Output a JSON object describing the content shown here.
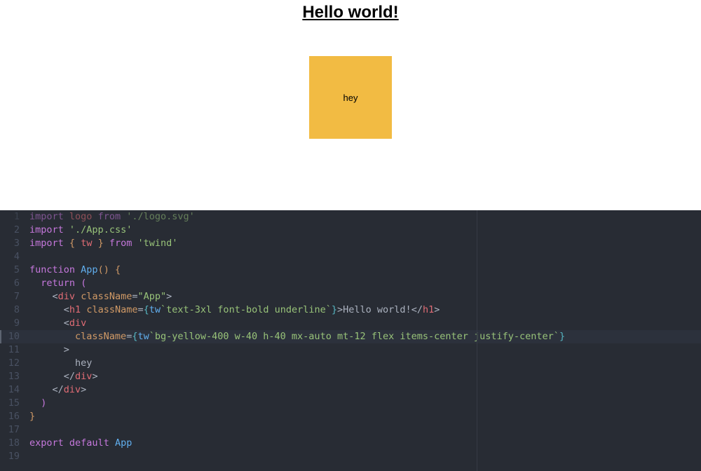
{
  "preview": {
    "heading": "Hello world!",
    "box_text": "hey"
  },
  "editor": {
    "lines": [
      {
        "n": "1",
        "html": "<span class='kw'>import</span> <span class='var'>logo</span> <span class='kw'>from</span> <span class='str'>'./logo.svg'</span>"
      },
      {
        "n": "2",
        "html": "<span class='kw'>import</span> <span class='str'>'./App.css'</span>"
      },
      {
        "n": "3",
        "html": "<span class='kw'>import</span> <span class='bracket1'>{</span> <span class='var'>tw</span> <span class='bracket1'>}</span> <span class='kw'>from</span> <span class='str'>'twind'</span>"
      },
      {
        "n": "4",
        "html": ""
      },
      {
        "n": "5",
        "html": "<span class='kw'>function</span> <span class='fn'>App</span><span class='bracket1'>()</span> <span class='bracket1'>{</span>"
      },
      {
        "n": "6",
        "html": "  <span class='kw'>return</span> <span class='bracket2'>(</span>"
      },
      {
        "n": "7",
        "html": "    <span class='punct'>&lt;</span><span class='tag'>div</span> <span class='attr'>className</span>=<span class='str'>\"App\"</span><span class='punct'>&gt;</span>"
      },
      {
        "n": "8",
        "html": "      <span class='punct'>&lt;</span><span class='tag'>h1</span> <span class='attr'>className</span>=<span class='bracket3'>{</span><span class='twcall'>tw</span><span class='tmpl'>`text-3xl font-bold underline`</span><span class='bracket3'>}</span><span class='punct'>&gt;</span><span class='txt'>Hello world!</span><span class='punct'>&lt;/</span><span class='tag'>h1</span><span class='punct'>&gt;</span>"
      },
      {
        "n": "9",
        "html": "      <span class='punct'>&lt;</span><span class='tag'>div</span>"
      },
      {
        "n": "10",
        "html": "        <span class='attr'>className</span>=<span class='bracket3'>{</span><span class='twcall'>tw</span><span class='tmpl'>`bg-yellow-400 w-40 h-40 mx-auto mt-12 flex items-center justify-center`</span><span class='bracket3'>}</span>",
        "hl": true
      },
      {
        "n": "11",
        "html": "      <span class='punct'>&gt;</span>"
      },
      {
        "n": "12",
        "html": "        <span class='txt'>hey</span>"
      },
      {
        "n": "13",
        "html": "      <span class='punct'>&lt;/</span><span class='tag'>div</span><span class='punct'>&gt;</span>"
      },
      {
        "n": "14",
        "html": "    <span class='punct'>&lt;/</span><span class='tag'>div</span><span class='punct'>&gt;</span>"
      },
      {
        "n": "15",
        "html": "  <span class='bracket2'>)</span>"
      },
      {
        "n": "16",
        "html": "<span class='bracket1'>}</span>"
      },
      {
        "n": "17",
        "html": ""
      },
      {
        "n": "18",
        "html": "<span class='kw'>export</span> <span class='kw'>default</span> <span class='fn'>App</span>"
      },
      {
        "n": "19",
        "html": ""
      }
    ]
  }
}
